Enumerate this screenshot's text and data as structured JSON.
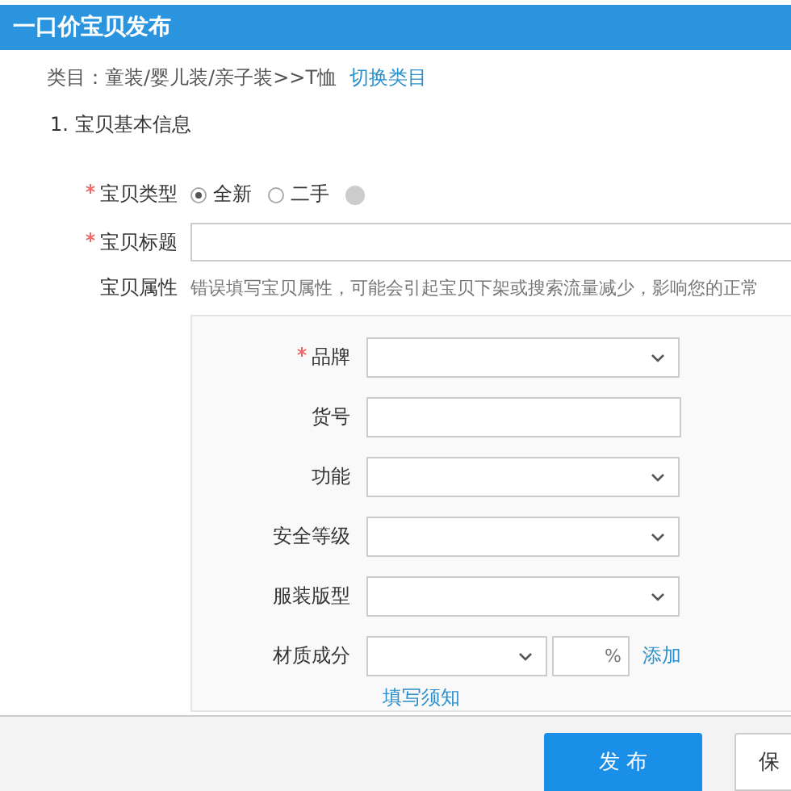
{
  "window": {
    "title": "一口价宝贝发布"
  },
  "category": {
    "label": "类目：童装/婴儿装/亲子装>>T恤",
    "link": "切换类目"
  },
  "section": "1. 宝贝基本信息",
  "item_type": {
    "label": "宝贝类型",
    "required": true,
    "options": [
      {
        "label": "全新",
        "selected": true
      },
      {
        "label": "二手",
        "selected": false
      }
    ]
  },
  "item_title": {
    "label": "宝贝标题",
    "required": true
  },
  "attributes": {
    "label": "宝贝属性",
    "hint": "错误填写宝贝属性，可能会引起宝贝下架或搜索流量减少，影响您的正常",
    "fields": [
      {
        "kind": "select",
        "label": "品牌",
        "required": true
      },
      {
        "kind": "input",
        "label": "货号",
        "required": false
      },
      {
        "kind": "select",
        "label": "功能",
        "required": false
      },
      {
        "kind": "select",
        "label": "安全等级",
        "required": false
      },
      {
        "kind": "select",
        "label": "服装版型",
        "required": false
      },
      {
        "kind": "material",
        "label": "材质成分",
        "required": false,
        "unit": "%",
        "add": "添加"
      }
    ],
    "help_link": "填写须知"
  },
  "buttons": [
    {
      "label": "发 布",
      "kind": "primary"
    },
    {
      "label": "保",
      "kind": "secondary"
    }
  ]
}
